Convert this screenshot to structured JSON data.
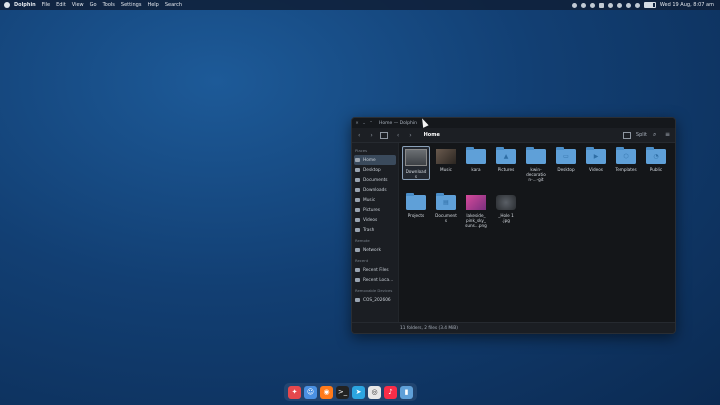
{
  "menubar": {
    "app_name": "Dolphin",
    "items": [
      "File",
      "Edit",
      "View",
      "Go",
      "Tools",
      "Settings",
      "Help",
      "Search"
    ],
    "clock": "Wed 19 Aug, 8:07 am",
    "battery_level": 0.8
  },
  "window": {
    "title": "Home — Dolphin",
    "close_glyph": "✕",
    "min_glyph": "⌄",
    "max_glyph": "⌃",
    "back_glyph": "‹",
    "forward_glyph": "›",
    "crumb_back": "‹",
    "crumb_forward": "›",
    "breadcrumb": "Home",
    "split_label": "Split",
    "search_glyph": "⌕",
    "menu_glyph": "≡",
    "status_text": "11 folders, 2 files (3.4 MiB)"
  },
  "sidebar": {
    "sections": [
      {
        "title": "Places",
        "items": [
          "Home",
          "Desktop",
          "Documents",
          "Downloads",
          "Music",
          "Pictures",
          "Videos",
          "Trash"
        ]
      },
      {
        "title": "Remote",
        "items": [
          "Network"
        ]
      },
      {
        "title": "Recent",
        "items": [
          "Recent Files",
          "Recent Loca..."
        ]
      },
      {
        "title": "Removable Devices",
        "items": [
          "COS_202606"
        ]
      }
    ]
  },
  "files": [
    {
      "name": "Download\ns",
      "kind": "thumb-dl"
    },
    {
      "name": "Music",
      "kind": "thumb-music"
    },
    {
      "name": "kara",
      "kind": "folder"
    },
    {
      "name": "Pictures",
      "kind": "folder",
      "glyph": "▲"
    },
    {
      "name": "kwin-\ndecoratio\nn-...-git",
      "kind": "folder"
    },
    {
      "name": "Desktop",
      "kind": "folder",
      "glyph": "▭"
    },
    {
      "name": "Videos",
      "kind": "folder",
      "glyph": "▶"
    },
    {
      "name": "Templates",
      "kind": "folder",
      "glyph": "⬡"
    },
    {
      "name": "Public",
      "kind": "folder",
      "glyph": "◔"
    },
    {
      "name": "Projects",
      "kind": "folder"
    },
    {
      "name": "Document\ns",
      "kind": "folder",
      "glyph": "▤"
    },
    {
      "name": "lakeside_\npink_sky_\nsuns...png",
      "kind": "thumb-pink"
    },
    {
      "name": "_Hole 1\n.jpg",
      "kind": "thumb-blur"
    }
  ],
  "dock": [
    {
      "name": "rocket",
      "color": "#e5484d",
      "glyph": "✦"
    },
    {
      "name": "finder",
      "color": "#4a90e2",
      "glyph": "☺"
    },
    {
      "name": "firefox",
      "color": "#ff7a1a",
      "glyph": "◉"
    },
    {
      "name": "terminal",
      "color": "#222222",
      "glyph": ">_"
    },
    {
      "name": "telegram",
      "color": "#2ca5e0",
      "glyph": "➤"
    },
    {
      "name": "camera",
      "color": "#e8e8e8",
      "glyph": "◎"
    },
    {
      "name": "music",
      "color": "#fa2d48",
      "glyph": "♪"
    },
    {
      "name": "files",
      "color": "#5fa0d8",
      "glyph": "▮"
    }
  ]
}
